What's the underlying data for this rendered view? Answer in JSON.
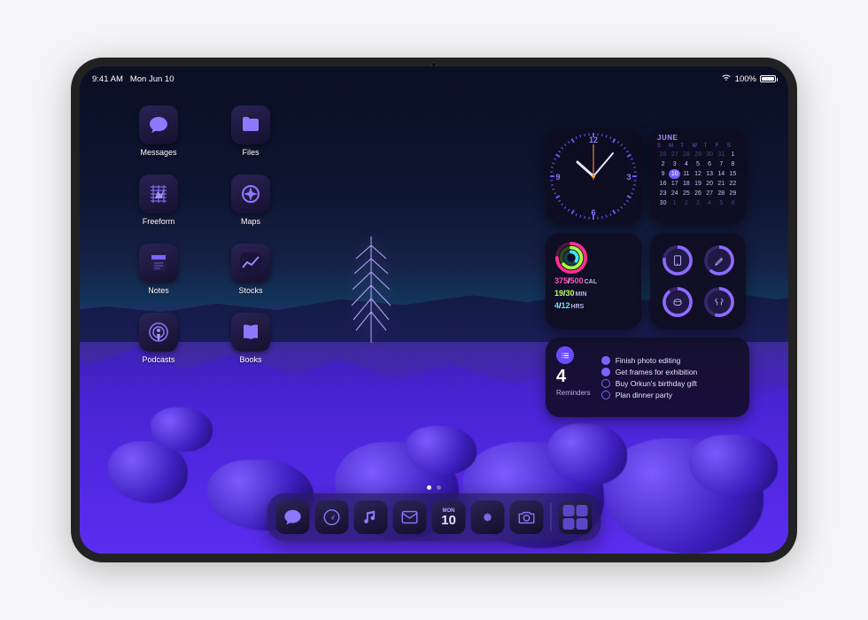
{
  "status": {
    "time": "9:41 AM",
    "date": "Mon Jun 10",
    "battery_pct": "100%"
  },
  "apps": {
    "messages": "Messages",
    "files": "Files",
    "freeform": "Freeform",
    "maps": "Maps",
    "notes": "Notes",
    "stocks": "Stocks",
    "podcasts": "Podcasts",
    "books": "Books"
  },
  "clock": {
    "n12": "12",
    "n3": "3",
    "n6": "6",
    "n9": "9"
  },
  "calendar": {
    "month": "JUNE",
    "dow": [
      "S",
      "M",
      "T",
      "W",
      "T",
      "F",
      "S"
    ],
    "today": 10,
    "cells": [
      {
        "d": 26,
        "dim": true
      },
      {
        "d": 27,
        "dim": true
      },
      {
        "d": 28,
        "dim": true
      },
      {
        "d": 29,
        "dim": true
      },
      {
        "d": 30,
        "dim": true
      },
      {
        "d": 31,
        "dim": true
      },
      {
        "d": 1
      },
      {
        "d": 2
      },
      {
        "d": 3
      },
      {
        "d": 4
      },
      {
        "d": 5
      },
      {
        "d": 6
      },
      {
        "d": 7
      },
      {
        "d": 8
      },
      {
        "d": 9
      },
      {
        "d": 10,
        "today": true
      },
      {
        "d": 11
      },
      {
        "d": 12
      },
      {
        "d": 13
      },
      {
        "d": 14
      },
      {
        "d": 15
      },
      {
        "d": 16
      },
      {
        "d": 17
      },
      {
        "d": 18
      },
      {
        "d": 19
      },
      {
        "d": 20
      },
      {
        "d": 21
      },
      {
        "d": 22
      },
      {
        "d": 23
      },
      {
        "d": 24
      },
      {
        "d": 25
      },
      {
        "d": 26
      },
      {
        "d": 27
      },
      {
        "d": 28
      },
      {
        "d": 29
      },
      {
        "d": 30
      },
      {
        "d": 1,
        "dim": true
      },
      {
        "d": 2,
        "dim": true
      },
      {
        "d": 3,
        "dim": true
      },
      {
        "d": 4,
        "dim": true
      },
      {
        "d": 5,
        "dim": true
      },
      {
        "d": 6,
        "dim": true
      }
    ]
  },
  "activity": {
    "cal_done": "375",
    "cal_goal": "500",
    "cal_unit": "CAL",
    "min_done": "19",
    "min_goal": "30",
    "min_unit": "MIN",
    "hrs_done": "4",
    "hrs_goal": "12",
    "hrs_unit": "HRS"
  },
  "batteries": {
    "ipad_pct": 78,
    "pencil_pct": 62,
    "airpods_case_pct": 90,
    "airpods_pct": 55
  },
  "reminders": {
    "title": "Reminders",
    "count": "4",
    "items": [
      {
        "text": "Finish photo editing",
        "filled": true
      },
      {
        "text": "Get frames for exhibition",
        "filled": true
      },
      {
        "text": "Buy Orkun's birthday gift",
        "filled": false
      },
      {
        "text": "Plan dinner party",
        "filled": false
      }
    ]
  },
  "dock": {
    "cal_dow": "MON",
    "cal_day": "10"
  },
  "colors": {
    "accent": "#7a5cff",
    "widget_bg": "#120e28"
  }
}
